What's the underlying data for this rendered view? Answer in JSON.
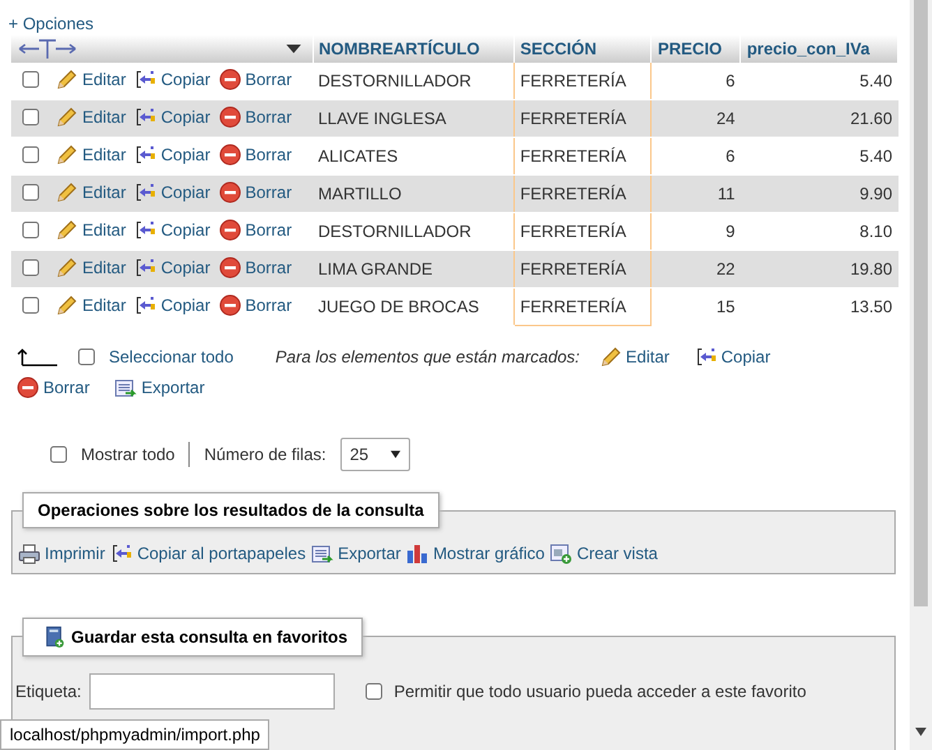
{
  "options_link": "+ Opciones",
  "table": {
    "columns": [
      {
        "label": "NOMBREARTÍCULO",
        "marked": false
      },
      {
        "label": "SECCIÓN",
        "marked": true
      },
      {
        "label": "PRECIO",
        "marked": false
      },
      {
        "label": "precio_con_IVa",
        "marked": false
      }
    ],
    "rows": [
      {
        "checked": false,
        "actions": [
          "Editar",
          "Copiar",
          "Borrar"
        ],
        "cells": [
          "DESTORNILLADOR",
          "FERRETERÍA",
          "6",
          "5.40"
        ]
      },
      {
        "checked": false,
        "actions": [
          "Editar",
          "Copiar",
          "Borrar"
        ],
        "cells": [
          "LLAVE INGLESA",
          "FERRETERÍA",
          "24",
          "21.60"
        ]
      },
      {
        "checked": false,
        "actions": [
          "Editar",
          "Copiar",
          "Borrar"
        ],
        "cells": [
          "ALICATES",
          "FERRETERÍA",
          "6",
          "5.40"
        ]
      },
      {
        "checked": false,
        "actions": [
          "Editar",
          "Copiar",
          "Borrar"
        ],
        "cells": [
          "MARTILLO",
          "FERRETERÍA",
          "11",
          "9.90"
        ]
      },
      {
        "checked": false,
        "actions": [
          "Editar",
          "Copiar",
          "Borrar"
        ],
        "cells": [
          "DESTORNILLADOR",
          "FERRETERÍA",
          "9",
          "8.10"
        ]
      },
      {
        "checked": false,
        "actions": [
          "Editar",
          "Copiar",
          "Borrar"
        ],
        "cells": [
          "LIMA GRANDE",
          "FERRETERÍA",
          "22",
          "19.80"
        ]
      },
      {
        "checked": false,
        "actions": [
          "Editar",
          "Copiar",
          "Borrar"
        ],
        "cells": [
          "JUEGO DE BROCAS",
          "FERRETERÍA",
          "15",
          "13.50"
        ]
      }
    ]
  },
  "bulk": {
    "select_all": {
      "label": "Seleccionar todo",
      "checked": false
    },
    "hint": "Para los elementos que están marcados:",
    "actions": [
      "Editar",
      "Copiar",
      "Borrar",
      "Exportar"
    ]
  },
  "paging": {
    "show_all": {
      "label": "Mostrar todo",
      "checked": false
    },
    "rows_label": "Número de filas:",
    "rows_value": "25"
  },
  "query_ops": {
    "title": "Operaciones sobre los resultados de la consulta",
    "actions": [
      "Imprimir",
      "Copiar al portapapeles",
      "Exportar",
      "Mostrar gráfico",
      "Crear vista"
    ]
  },
  "bookmark": {
    "title": "Guardar esta consulta en favoritos",
    "label": "Etiqueta:",
    "share": {
      "label": "Permitir que todo usuario pueda acceder a este favorito",
      "checked": false
    }
  },
  "status_url": "localhost/phpmyadmin/import.php"
}
